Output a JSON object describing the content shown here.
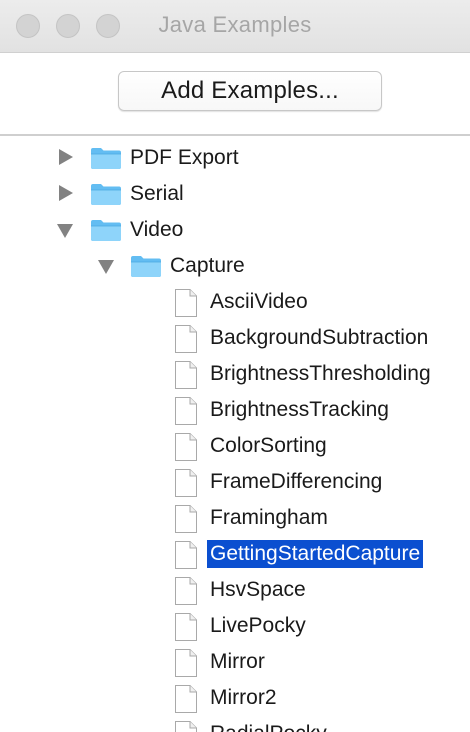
{
  "window": {
    "title": "Java Examples"
  },
  "toolbar": {
    "add_label": "Add Examples..."
  },
  "tree": {
    "items": [
      {
        "label": "PDF Export",
        "type": "folder",
        "expanded": false,
        "level": 0
      },
      {
        "label": "Serial",
        "type": "folder",
        "expanded": false,
        "level": 0
      },
      {
        "label": "Video",
        "type": "folder",
        "expanded": true,
        "level": 0
      },
      {
        "label": "Capture",
        "type": "folder",
        "expanded": true,
        "level": 1
      },
      {
        "label": "AsciiVideo",
        "type": "file",
        "level": 2
      },
      {
        "label": "BackgroundSubtraction",
        "type": "file",
        "level": 2
      },
      {
        "label": "BrightnessThresholding",
        "type": "file",
        "level": 2
      },
      {
        "label": "BrightnessTracking",
        "type": "file",
        "level": 2
      },
      {
        "label": "ColorSorting",
        "type": "file",
        "level": 2
      },
      {
        "label": "FrameDifferencing",
        "type": "file",
        "level": 2
      },
      {
        "label": "Framingham",
        "type": "file",
        "level": 2
      },
      {
        "label": "GettingStartedCapture",
        "type": "file",
        "level": 2,
        "selected": true
      },
      {
        "label": "HsvSpace",
        "type": "file",
        "level": 2
      },
      {
        "label": "LivePocky",
        "type": "file",
        "level": 2
      },
      {
        "label": "Mirror",
        "type": "file",
        "level": 2
      },
      {
        "label": "Mirror2",
        "type": "file",
        "level": 2
      },
      {
        "label": "RadialPocky",
        "type": "file",
        "level": 2
      }
    ]
  },
  "colors": {
    "selection": "#0b4fd0",
    "folder": "#6cc4f5"
  }
}
